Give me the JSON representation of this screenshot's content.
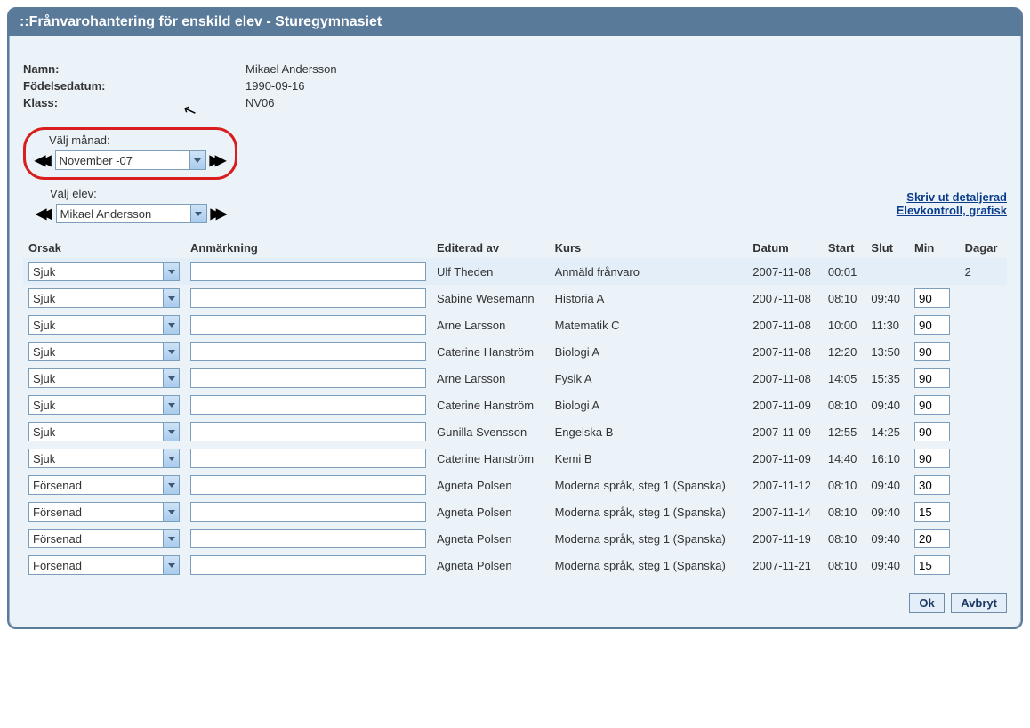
{
  "window_title": "::Frånvarohantering för enskild elev - Sturegymnasiet",
  "info": {
    "name_label": "Namn:",
    "name_value": "Mikael Andersson",
    "dob_label": "Födelsedatum:",
    "dob_value": "1990-09-16",
    "class_label": "Klass:",
    "class_value": "NV06"
  },
  "month_selector": {
    "label": "Välj månad:",
    "value": "November -07"
  },
  "student_selector": {
    "label": "Välj elev:",
    "value": "Mikael Andersson"
  },
  "links": {
    "print": "Skriv ut detaljerad",
    "graph": "Elevkontroll, grafisk"
  },
  "headers": {
    "orsak": "Orsak",
    "anm": "Anmärkning",
    "editerad": "Editerad av",
    "kurs": "Kurs",
    "datum": "Datum",
    "start": "Start",
    "slut": "Slut",
    "min": "Min",
    "dagar": "Dagar"
  },
  "rows": [
    {
      "orsak": "Sjuk",
      "anm": "",
      "edit": "Ulf Theden",
      "kurs": "Anmäld frånvaro",
      "datum": "2007-11-08",
      "start": "00:01",
      "slut": "",
      "min": "",
      "dagar": "2",
      "hl": true
    },
    {
      "orsak": "Sjuk",
      "anm": "",
      "edit": "Sabine Wesemann",
      "kurs": "Historia A",
      "datum": "2007-11-08",
      "start": "08:10",
      "slut": "09:40",
      "min": "90",
      "dagar": ""
    },
    {
      "orsak": "Sjuk",
      "anm": "",
      "edit": "Arne Larsson",
      "kurs": "Matematik C",
      "datum": "2007-11-08",
      "start": "10:00",
      "slut": "11:30",
      "min": "90",
      "dagar": ""
    },
    {
      "orsak": "Sjuk",
      "anm": "",
      "edit": "Caterine Hanström",
      "kurs": "Biologi A",
      "datum": "2007-11-08",
      "start": "12:20",
      "slut": "13:50",
      "min": "90",
      "dagar": ""
    },
    {
      "orsak": "Sjuk",
      "anm": "",
      "edit": "Arne Larsson",
      "kurs": "Fysik A",
      "datum": "2007-11-08",
      "start": "14:05",
      "slut": "15:35",
      "min": "90",
      "dagar": ""
    },
    {
      "orsak": "Sjuk",
      "anm": "",
      "edit": "Caterine Hanström",
      "kurs": "Biologi A",
      "datum": "2007-11-09",
      "start": "08:10",
      "slut": "09:40",
      "min": "90",
      "dagar": ""
    },
    {
      "orsak": "Sjuk",
      "anm": "",
      "edit": "Gunilla Svensson",
      "kurs": "Engelska B",
      "datum": "2007-11-09",
      "start": "12:55",
      "slut": "14:25",
      "min": "90",
      "dagar": ""
    },
    {
      "orsak": "Sjuk",
      "anm": "",
      "edit": "Caterine Hanström",
      "kurs": "Kemi B",
      "datum": "2007-11-09",
      "start": "14:40",
      "slut": "16:10",
      "min": "90",
      "dagar": ""
    },
    {
      "orsak": "Försenad",
      "anm": "",
      "edit": "Agneta Polsen",
      "kurs": "Moderna språk, steg 1 (Spanska)",
      "datum": "2007-11-12",
      "start": "08:10",
      "slut": "09:40",
      "min": "30",
      "dagar": ""
    },
    {
      "orsak": "Försenad",
      "anm": "",
      "edit": "Agneta Polsen",
      "kurs": "Moderna språk, steg 1 (Spanska)",
      "datum": "2007-11-14",
      "start": "08:10",
      "slut": "09:40",
      "min": "15",
      "dagar": ""
    },
    {
      "orsak": "Försenad",
      "anm": "",
      "edit": "Agneta Polsen",
      "kurs": "Moderna språk, steg 1 (Spanska)",
      "datum": "2007-11-19",
      "start": "08:10",
      "slut": "09:40",
      "min": "20",
      "dagar": ""
    },
    {
      "orsak": "Försenad",
      "anm": "",
      "edit": "Agneta Polsen",
      "kurs": "Moderna språk, steg 1 (Spanska)",
      "datum": "2007-11-21",
      "start": "08:10",
      "slut": "09:40",
      "min": "15",
      "dagar": ""
    }
  ],
  "buttons": {
    "ok": "Ok",
    "cancel": "Avbryt"
  }
}
